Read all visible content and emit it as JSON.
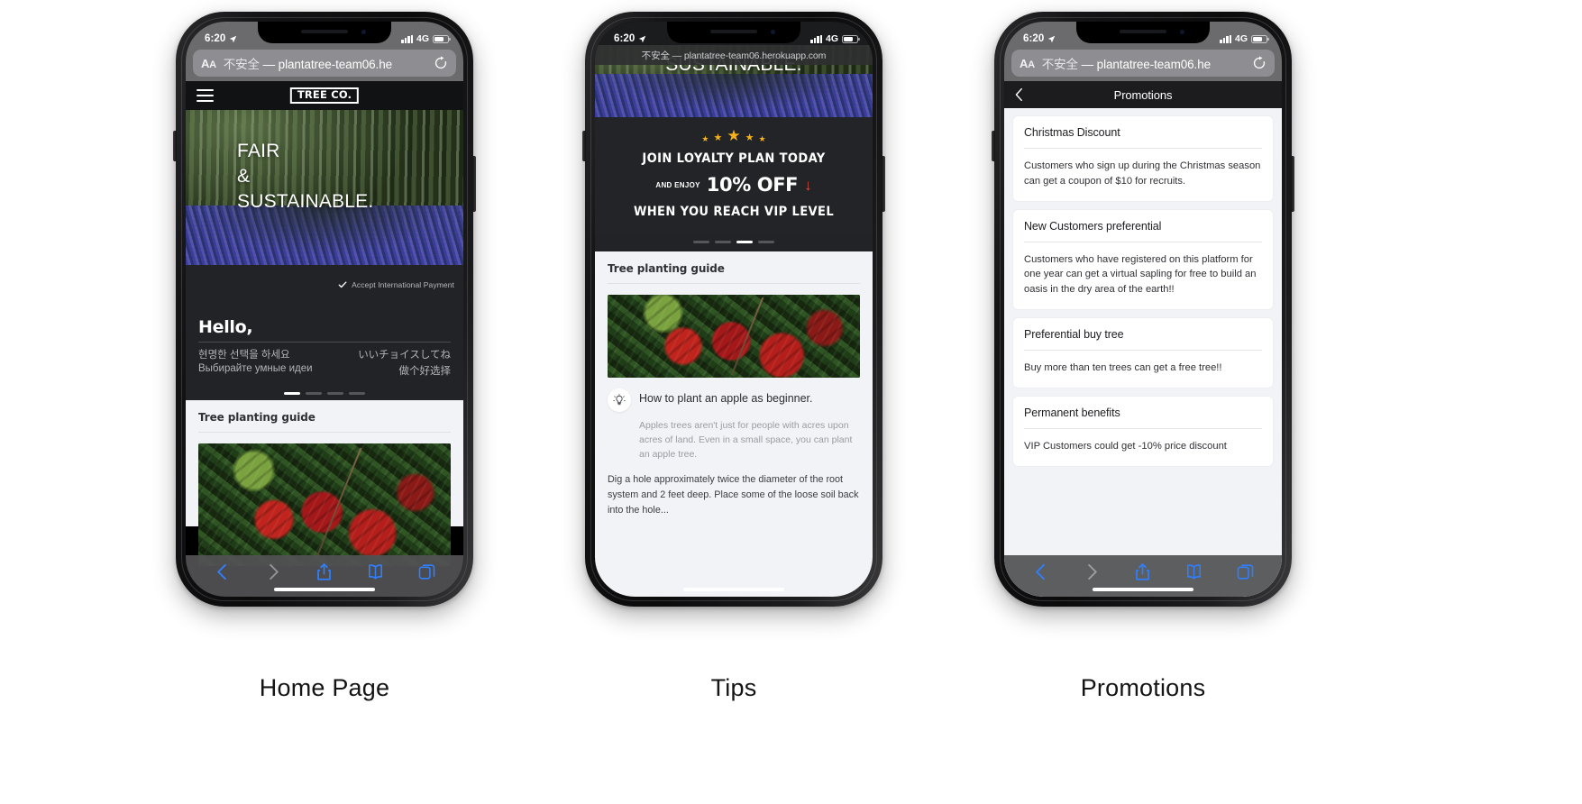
{
  "captions": {
    "home": "Home Page",
    "tips": "Tips",
    "promotions": "Promotions"
  },
  "status_bar": {
    "time": "6:20",
    "network": "4G"
  },
  "browser": {
    "aa_label": "AA",
    "security_warning": "不安全",
    "separator": "—",
    "url_phone1": "plantatree-team06.he",
    "url_phone2": "不安全 — plantatree-team06.herokuapp.com",
    "url_phone3": "plantatree-team06.he"
  },
  "phone1": {
    "site_logo": "TREE CO.",
    "hero_line1": "FAIR",
    "hero_line2": "&",
    "hero_line3": "SUSTAINABLE.",
    "accept_payment": "Accept International Payment",
    "hello_title": "Hello,",
    "lang_lines": [
      {
        "left": "현명한 선택을 하세요",
        "right": "いいチョイスしてね"
      },
      {
        "left": "Выбирайте умные идеи",
        "right": "做个好选择"
      }
    ],
    "active_dot": 0,
    "dot_count": 4,
    "card_title": "Tree planting guide"
  },
  "phone2": {
    "hero_text": "SUSTAINABLE.",
    "loyalty_line1": "JOIN LOYALTY PLAN TODAY",
    "loyalty_and_enjoy": "AND ENJOY",
    "loyalty_percent": "10% OFF",
    "loyalty_arrow": "↓",
    "loyalty_line3": "WHEN YOU REACH VIP LEVEL",
    "active_dot": 2,
    "dot_count": 4,
    "card_title": "Tree planting guide",
    "tip_heading": "How to plant an apple as beginner.",
    "tip_body": "Apples trees aren't just for people with acres upon acres of land. Even in a small space, you can plant an apple tree.",
    "tip_more": "Dig a hole approximately twice the diameter of the root system and 2 feet deep. Place some of the loose soil back into the hole..."
  },
  "phone3": {
    "nav_title": "Promotions",
    "promotions": [
      {
        "title": "Christmas Discount",
        "body": "Customers who sign up during the Christmas season can get a coupon of $10 for recruits."
      },
      {
        "title": "New Customers preferential",
        "body": "Customers who have registered on this platform for one year can get a virtual sapling for free to build an oasis in the dry area of the earth!!"
      },
      {
        "title": "Preferential buy tree",
        "body": "Buy more than ten trees can get a free tree!!"
      },
      {
        "title": "Permanent benefits",
        "body": "VIP Customers could get -10% price discount"
      }
    ]
  },
  "colors": {
    "ios_blue": "#2f7fff",
    "star_gold": "#f5b21b",
    "arrow_red": "#e0483c",
    "sheet_bg": "#f2f3f6",
    "dark_bg": "#222326"
  }
}
